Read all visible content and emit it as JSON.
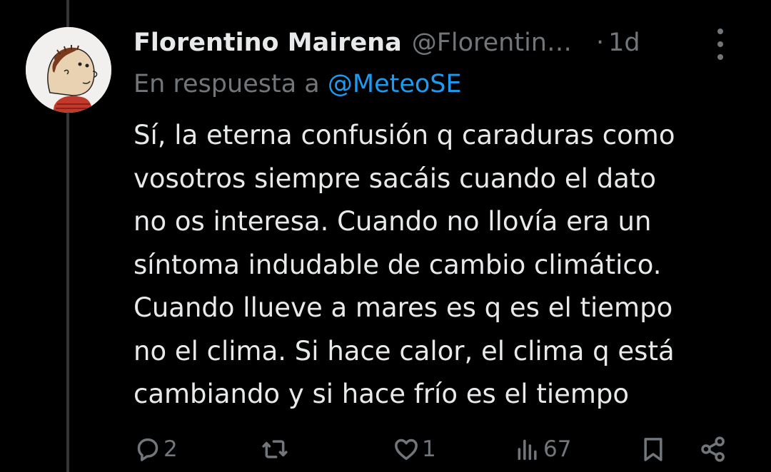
{
  "tweet": {
    "author": {
      "name": "Florentino Mairena",
      "handle": "@Florentin…",
      "avatar_icon": "avatar-icon"
    },
    "separator": "·",
    "time": "1d",
    "reply": {
      "prefix": "En respuesta a",
      "mention": "@MeteoSE"
    },
    "text_lines": [
      "Sí, la eterna confusión q caraduras como",
      "vosotros siempre sacáis cuando el dato",
      "no os interesa. Cuando no llovía era un",
      "síntoma indudable de cambio climático.",
      "Cuando llueve a mares es q es el tiempo",
      "no el clima. Si hace calor, el clima q está",
      "cambiando y si hace frío es el tiempo"
    ],
    "actions": {
      "replies": "2",
      "retweets": "",
      "likes": "1",
      "views": "67"
    }
  },
  "colors": {
    "background": "#000000",
    "text": "#e7e9ea",
    "muted": "#71767b",
    "link": "#1d9bf0"
  }
}
